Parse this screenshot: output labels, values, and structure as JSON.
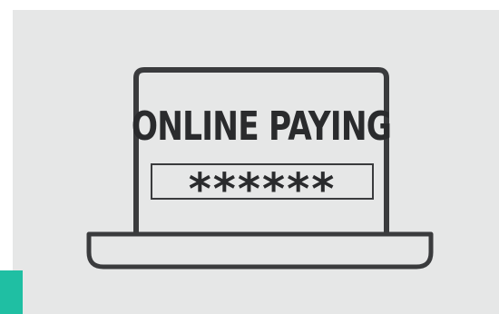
{
  "illustration": {
    "title": "ONLINE PAYING",
    "password_mask": "******",
    "icon": "laptop-icon"
  },
  "colors": {
    "background": "#e6e7e7",
    "outline": "#3a3b3d",
    "text": "#2a2b2d",
    "accent": "#1fbfa3"
  }
}
